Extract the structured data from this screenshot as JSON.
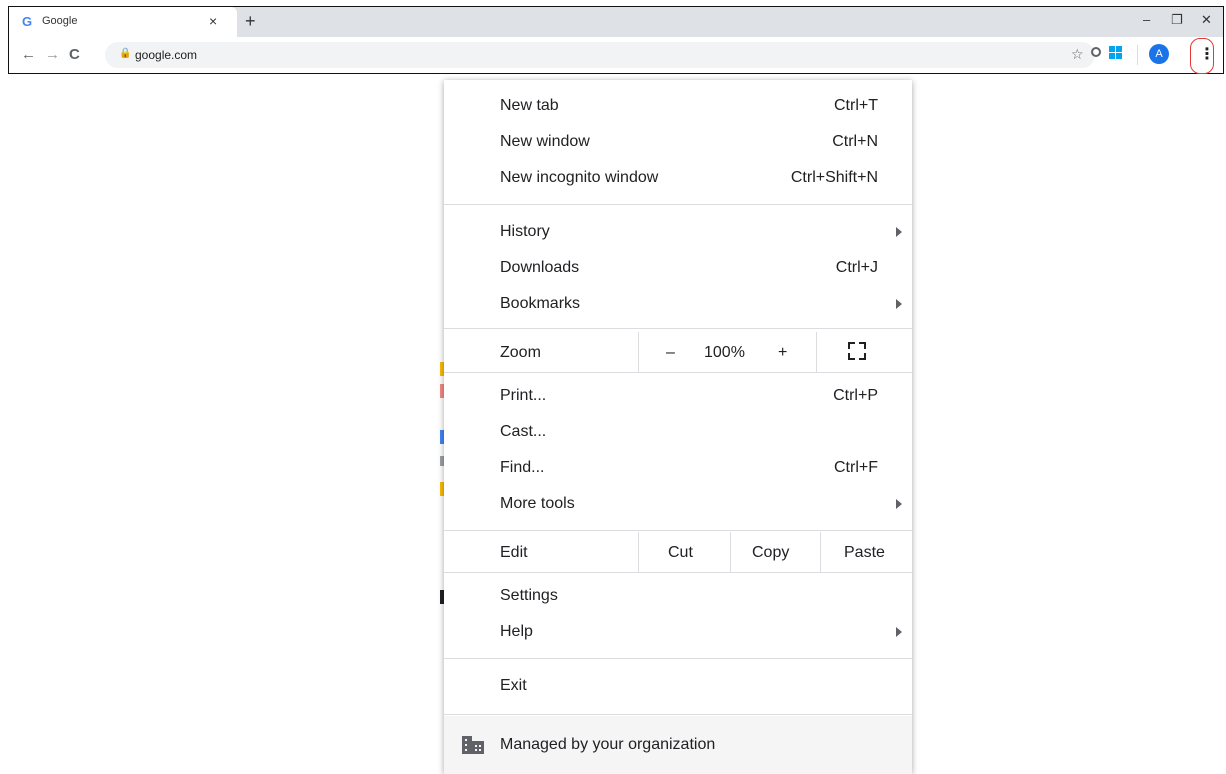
{
  "tab": {
    "title": "Google",
    "close": "×",
    "new": "+"
  },
  "window_controls": {
    "minimize": "–",
    "restore": "❐",
    "close": "✕"
  },
  "toolbar": {
    "back": "←",
    "forward": "→",
    "reload": "C",
    "url": "google.com",
    "star": "☆",
    "avatar_initial": "A",
    "menu": "⋮"
  },
  "menu": {
    "new_tab": {
      "label": "New tab",
      "shortcut": "Ctrl+T"
    },
    "new_window": {
      "label": "New window",
      "shortcut": "Ctrl+N"
    },
    "incognito": {
      "label": "New incognito window",
      "shortcut": "Ctrl+Shift+N"
    },
    "history": {
      "label": "History"
    },
    "downloads": {
      "label": "Downloads",
      "shortcut": "Ctrl+J"
    },
    "bookmarks": {
      "label": "Bookmarks"
    },
    "zoom": {
      "label": "Zoom",
      "minus": "–",
      "level": "100%",
      "plus": "+"
    },
    "print": {
      "label": "Print...",
      "shortcut": "Ctrl+P"
    },
    "cast": {
      "label": "Cast..."
    },
    "find": {
      "label": "Find...",
      "shortcut": "Ctrl+F"
    },
    "more_tools": {
      "label": "More tools"
    },
    "edit": {
      "label": "Edit",
      "cut": "Cut",
      "copy": "Copy",
      "paste": "Paste"
    },
    "settings": {
      "label": "Settings"
    },
    "help": {
      "label": "Help"
    },
    "exit": {
      "label": "Exit"
    },
    "managed": {
      "label": "Managed by your organization"
    }
  }
}
